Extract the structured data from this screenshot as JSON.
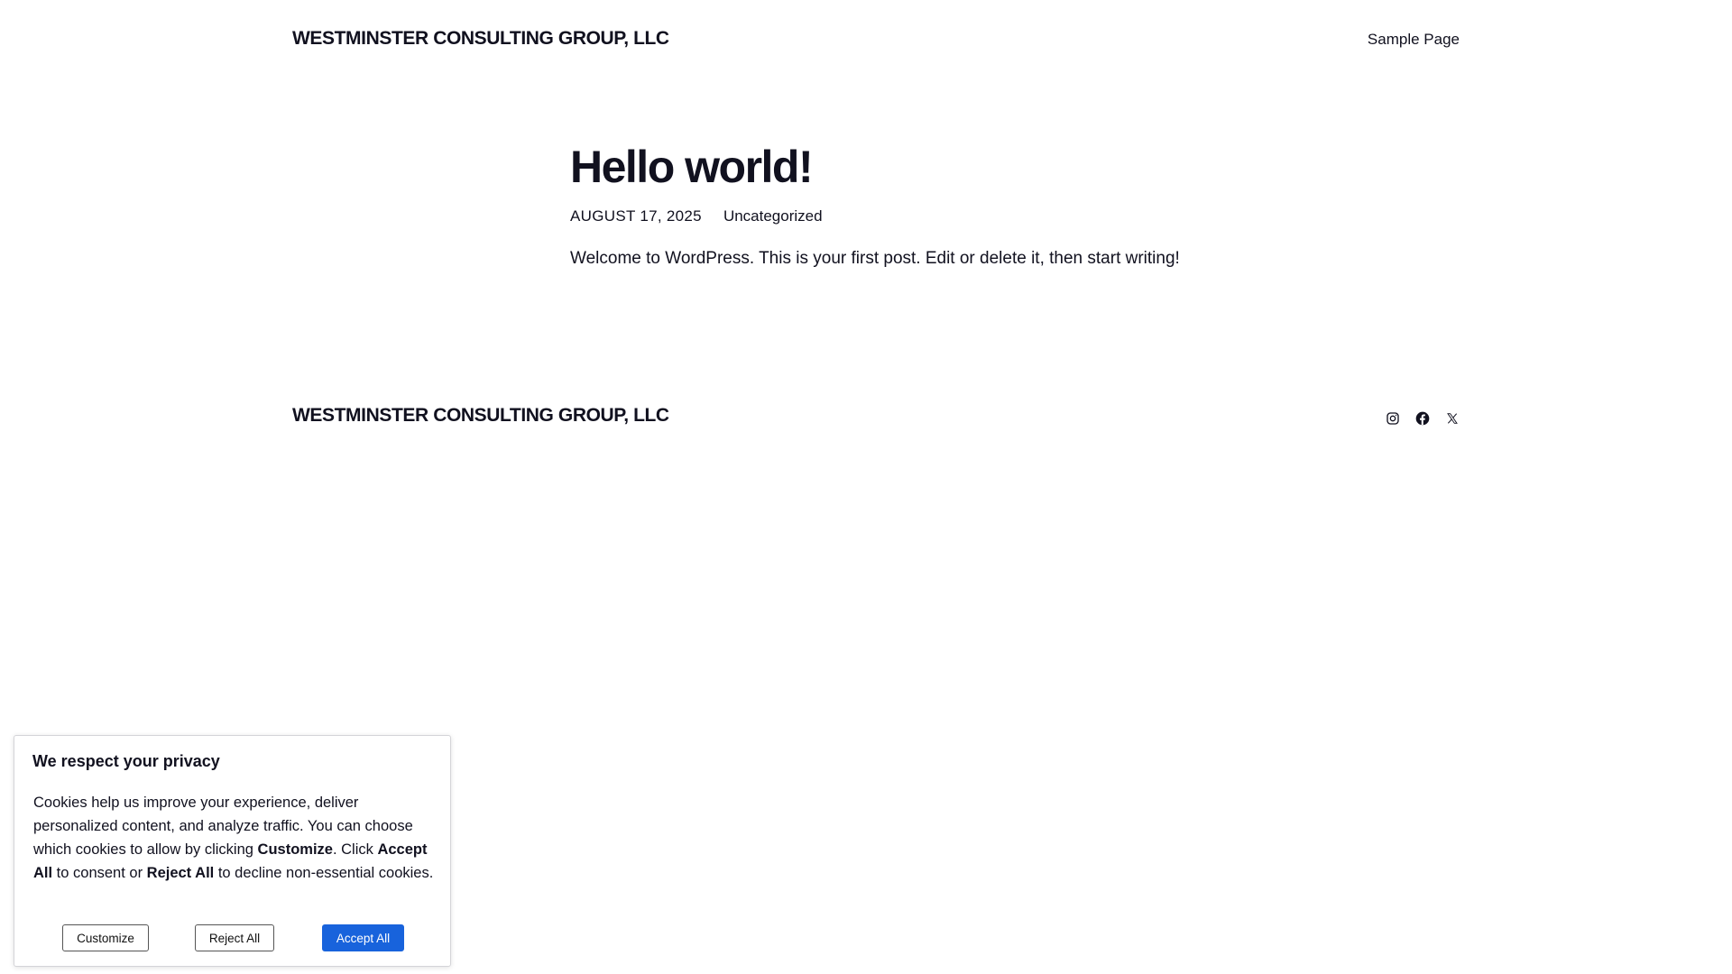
{
  "header": {
    "site_title": "WESTMINSTER CONSULTING GROUP, LLC",
    "nav": [
      {
        "label": "Sample Page"
      }
    ]
  },
  "post": {
    "title": "Hello world!",
    "date": "AUGUST 17, 2025",
    "category": "Uncategorized",
    "body": "Welcome to WordPress. This is your first post. Edit or delete it, then start writing!"
  },
  "footer": {
    "site_title": "WESTMINSTER CONSULTING GROUP, LLC",
    "social": [
      {
        "icon": "instagram-icon"
      },
      {
        "icon": "facebook-icon"
      },
      {
        "icon": "x-icon"
      }
    ]
  },
  "cookie_banner": {
    "heading": "We respect your privacy",
    "text_part1": "Cookies help us improve your experience, deliver personalized content, and analyze traffic. You can choose which cookies to allow by clicking ",
    "text_bold1": "Customize",
    "text_part2": ". Click ",
    "text_bold2": "Accept All",
    "text_part3": " to consent or ",
    "text_bold3": "Reject All",
    "text_part4": " to decline non-essential cookies.",
    "buttons": {
      "customize": "Customize",
      "reject": "Reject All",
      "accept": "Accept All"
    },
    "accent_color": "#1863dc"
  }
}
